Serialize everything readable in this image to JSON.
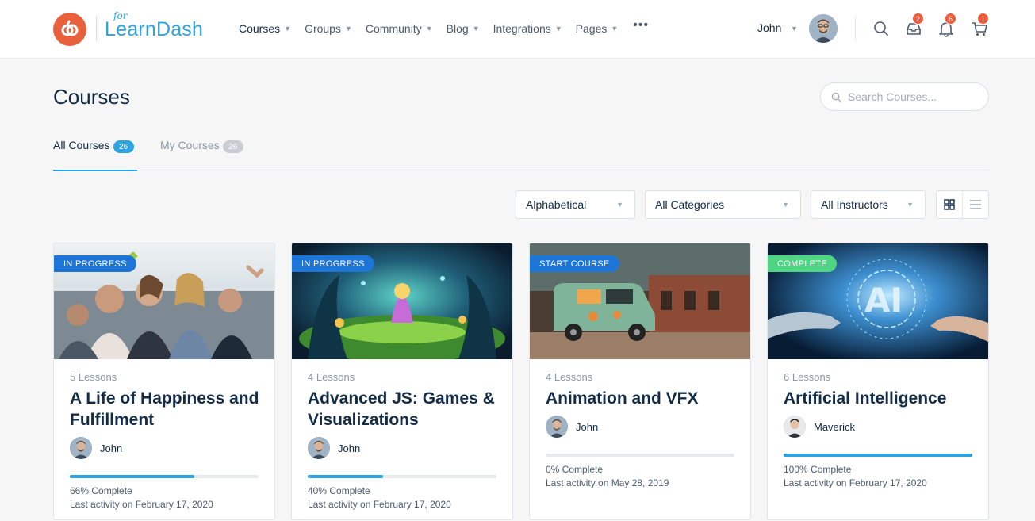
{
  "brand": {
    "for": "for",
    "name": "LearnDash",
    "color": "#2da3e0",
    "logo_color": "#e8603c"
  },
  "nav": [
    {
      "label": "Courses",
      "active": true
    },
    {
      "label": "Groups"
    },
    {
      "label": "Community"
    },
    {
      "label": "Blog"
    },
    {
      "label": "Integrations"
    },
    {
      "label": "Pages"
    }
  ],
  "more_icon": "ellipsis-icon",
  "user": {
    "name": "John"
  },
  "icons": {
    "search": "search-icon",
    "messages": "inbox-icon",
    "notifications": "bell-icon",
    "cart": "cart-icon"
  },
  "badges": {
    "messages": "2",
    "notifications": "6",
    "cart": "1"
  },
  "page": {
    "title": "Courses"
  },
  "search": {
    "placeholder": "Search Courses..."
  },
  "tabs": [
    {
      "label": "All Courses",
      "count": "26",
      "active": true
    },
    {
      "label": "My Courses",
      "count": "26",
      "active": false
    }
  ],
  "filters": {
    "order": "Alphabetical",
    "category": "All Categories",
    "instructor": "All Instructors"
  },
  "colors": {
    "accent": "#2da3e0",
    "in_progress": "#1d75d8",
    "start": "#1d75d8",
    "complete": "#4fd484",
    "badge": "#ef5a38"
  },
  "courses": [
    {
      "status": "IN PROGRESS",
      "status_color": "#1d75d8",
      "lessons": "5 Lessons",
      "title": "A Life of Happiness and Fulfillment",
      "author": "John",
      "progress": 66,
      "pct_label": "66% Complete",
      "last_activity": "Last activity on February 17, 2020"
    },
    {
      "status": "IN PROGRESS",
      "status_color": "#1d75d8",
      "lessons": "4 Lessons",
      "title": "Advanced JS: Games & Visualizations",
      "author": "John",
      "progress": 40,
      "pct_label": "40% Complete",
      "last_activity": "Last activity on February 17, 2020"
    },
    {
      "status": "START COURSE",
      "status_color": "#1d75d8",
      "lessons": "4 Lessons",
      "title": "Animation and VFX",
      "author": "John",
      "progress": 0,
      "pct_label": "0% Complete",
      "last_activity": "Last activity on May 28, 2019"
    },
    {
      "status": "COMPLETE",
      "status_color": "#4fd484",
      "lessons": "6 Lessons",
      "title": "Artificial Intelligence",
      "author": "Maverick",
      "progress": 100,
      "pct_label": "100% Complete",
      "last_activity": "Last activity on February 17, 2020"
    }
  ]
}
